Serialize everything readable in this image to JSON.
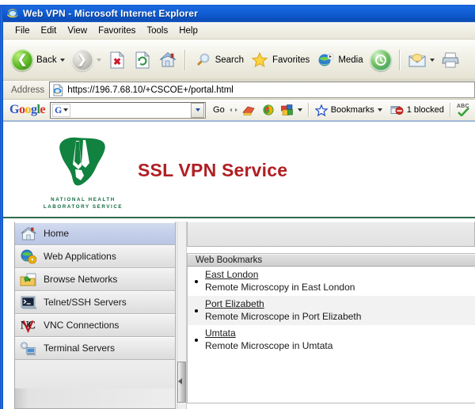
{
  "window": {
    "title": "Web VPN - Microsoft Internet Explorer",
    "icon": "ie-icon"
  },
  "menubar": {
    "items": [
      {
        "label": "File"
      },
      {
        "label": "Edit"
      },
      {
        "label": "View"
      },
      {
        "label": "Favorites"
      },
      {
        "label": "Tools"
      },
      {
        "label": "Help"
      }
    ]
  },
  "toolbar": {
    "back_label": "Back",
    "forward_label": "",
    "stop_label": "",
    "refresh_label": "",
    "home_label": "",
    "search_label": "Search",
    "favorites_label": "Favorites",
    "media_label": "Media",
    "history_label": "",
    "mail_label": "",
    "print_label": ""
  },
  "address": {
    "label": "Address",
    "url": "https://196.7.68.10/+CSCOE+/portal.html",
    "favicon": "ie-page-icon"
  },
  "google_toolbar": {
    "logo": "Google",
    "search_value": "",
    "search_prefix": "G",
    "go_label": "Go",
    "bookmarks_label": "Bookmarks",
    "blocked_label": "1 blocked",
    "check_label": "Ch",
    "check_badge": "ABC"
  },
  "banner": {
    "title": "SSL VPN Service",
    "logo_line1": "NATIONAL HEALTH",
    "logo_line2": "LABORATORY SERVICE",
    "logo_color": "#0f6b3f",
    "title_color": "#b01f24"
  },
  "sidebar": {
    "items": [
      {
        "label": "Home",
        "icon": "home-icon",
        "active": true
      },
      {
        "label": "Web Applications",
        "icon": "globe-gear-icon",
        "active": false
      },
      {
        "label": "Browse Networks",
        "icon": "folder-arrow-icon",
        "active": false
      },
      {
        "label": "Telnet/SSH Servers",
        "icon": "terminal-icon",
        "active": false
      },
      {
        "label": "VNC Connections",
        "icon": "vnc-icon",
        "active": false
      },
      {
        "label": "Terminal Servers",
        "icon": "terminal-server-icon",
        "active": false
      }
    ]
  },
  "content": {
    "bookmarks_title": "Web Bookmarks",
    "bookmarks": [
      {
        "link": "East London",
        "description": "Remote Microscopy in East London"
      },
      {
        "link": "Port Elizabeth",
        "description": "Remote Microscope in Port Elizabeth"
      },
      {
        "link": "Umtata",
        "description": "Remote Microscope in Umtata"
      }
    ]
  }
}
